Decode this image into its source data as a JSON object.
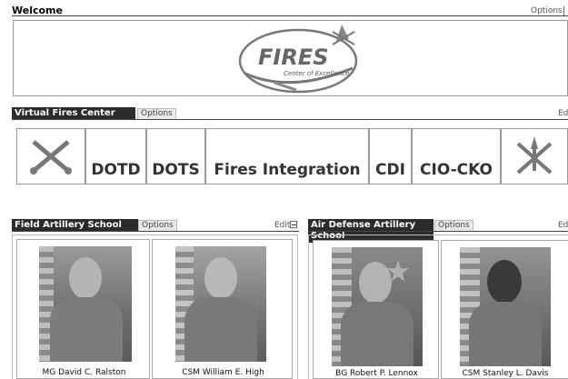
{
  "welcome": {
    "title": "Welcome",
    "options_label": "Options"
  },
  "logo": {
    "main": "FIRES",
    "sub": "Center of Excellence"
  },
  "vfc": {
    "title": "Virtual Fires Center",
    "options_label": "Options",
    "edit_label": "Ed",
    "tiles": [
      "DOTD",
      "DOTS",
      "Fires Integration",
      "CDI",
      "CIO-CKO"
    ]
  },
  "fas": {
    "title": "Field Artillery School",
    "options_label": "Options",
    "edit_label": "Edit",
    "people": [
      "MG David C. Ralston",
      "CSM William E. High"
    ]
  },
  "ada": {
    "title": "Air Defense Artillery School",
    "options_label": "Options",
    "edit_label": "Ed",
    "people": [
      "BG Robert P. Lennox",
      "CSM Stanley L. Davis"
    ]
  }
}
